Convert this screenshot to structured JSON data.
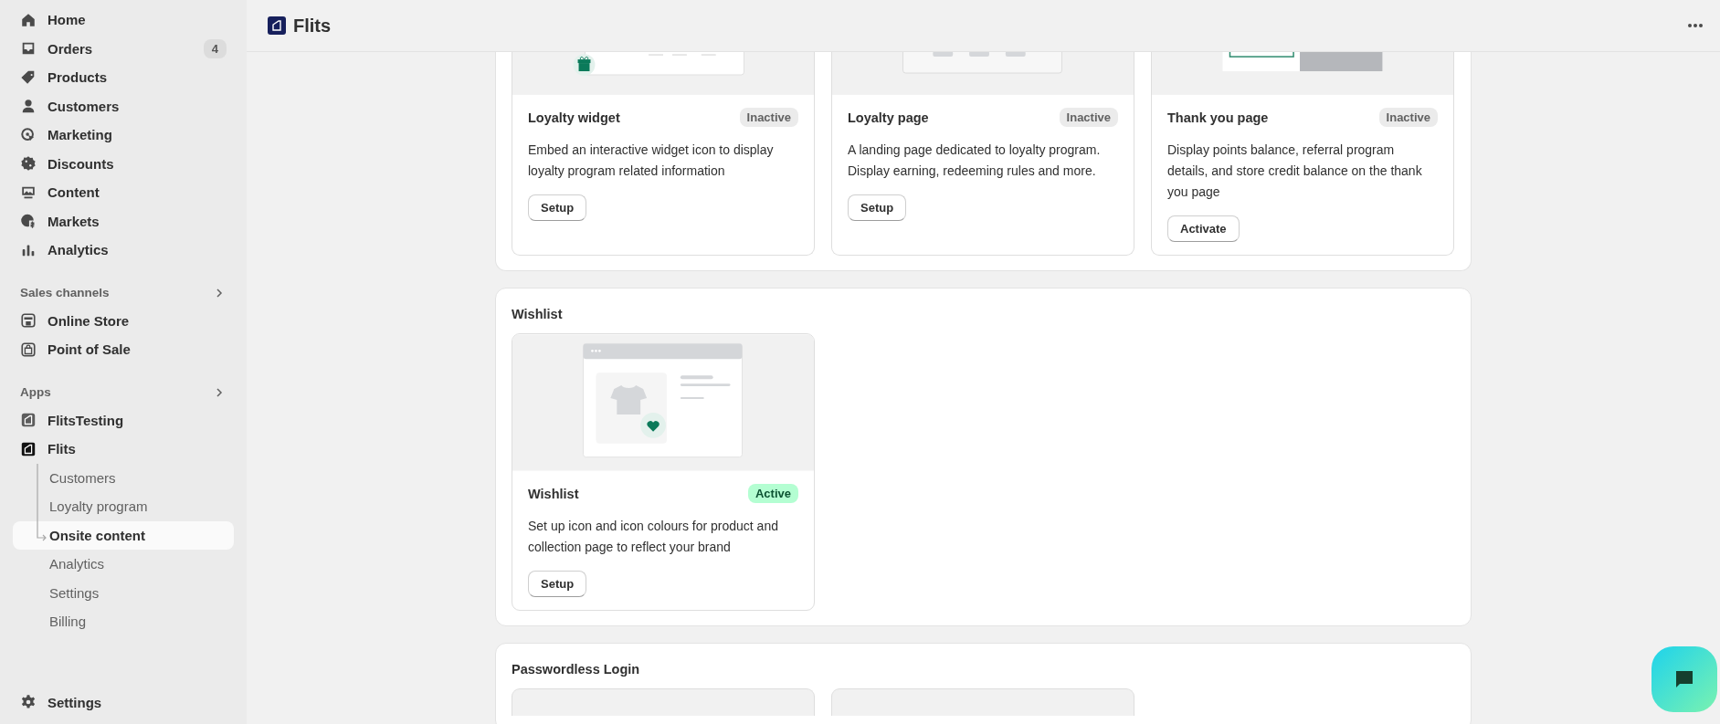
{
  "sidebar": {
    "nav": [
      {
        "label": "Home"
      },
      {
        "label": "Orders",
        "badge": "4"
      },
      {
        "label": "Products"
      },
      {
        "label": "Customers"
      },
      {
        "label": "Marketing"
      },
      {
        "label": "Discounts"
      },
      {
        "label": "Content"
      },
      {
        "label": "Markets"
      },
      {
        "label": "Analytics"
      }
    ],
    "groups": [
      {
        "title": "Sales channels",
        "items": [
          {
            "label": "Online Store"
          },
          {
            "label": "Point of Sale"
          }
        ]
      },
      {
        "title": "Apps",
        "items": [
          {
            "label": "FlitsTesting"
          },
          {
            "label": "Flits",
            "children": [
              {
                "label": "Customers",
                "selected": false
              },
              {
                "label": "Loyalty program",
                "selected": false
              },
              {
                "label": "Onsite content",
                "selected": true
              },
              {
                "label": "Analytics",
                "selected": false
              },
              {
                "label": "Settings",
                "selected": false
              },
              {
                "label": "Billing",
                "selected": false
              }
            ]
          }
        ]
      }
    ],
    "footer": {
      "label": "Settings"
    }
  },
  "header": {
    "title": "Flits"
  },
  "sections": [
    {
      "cards": [
        {
          "kind": "feature",
          "title": "Loyalty widget",
          "status": "Inactive",
          "active": false,
          "description": "Embed an interactive widget icon to display loyalty program related information",
          "button": "Setup"
        },
        {
          "kind": "feature",
          "title": "Loyalty page",
          "status": "Inactive",
          "active": false,
          "description": "A landing page dedicated to loyalty program. Display earning, redeeming rules and more.",
          "button": "Setup"
        },
        {
          "kind": "feature",
          "title": "Thank you page",
          "status": "Inactive",
          "active": false,
          "description": "Display points balance, referral program details, and store credit balance on the thank you page",
          "button": "Activate"
        }
      ]
    },
    {
      "title": "Wishlist",
      "cards": [
        {
          "kind": "feature",
          "title": "Wishlist",
          "status": "Active",
          "active": true,
          "description": "Set up icon and icon colours for product and collection page to reflect your brand",
          "button": "Setup"
        }
      ]
    },
    {
      "title": "Passwordless Login",
      "cards": [
        {
          "kind": "preview"
        },
        {
          "kind": "preview"
        }
      ]
    }
  ]
}
